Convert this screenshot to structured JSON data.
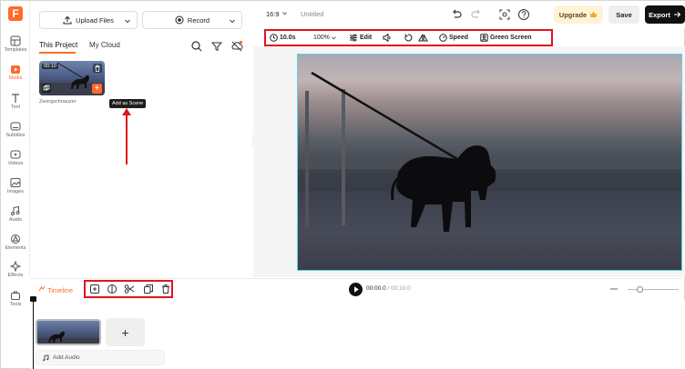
{
  "app": {
    "logo_letter": "F"
  },
  "rail": {
    "items": [
      {
        "label": "Templates",
        "icon": "templates-icon"
      },
      {
        "label": "Media",
        "icon": "media-icon",
        "active": true
      },
      {
        "label": "Text",
        "icon": "text-icon"
      },
      {
        "label": "Subtitles",
        "icon": "subtitles-icon"
      },
      {
        "label": "Videos",
        "icon": "videos-icon"
      },
      {
        "label": "Images",
        "icon": "images-icon"
      },
      {
        "label": "Audio",
        "icon": "audio-icon"
      },
      {
        "label": "Elements",
        "icon": "elements-icon"
      },
      {
        "label": "Effects",
        "icon": "effects-icon"
      },
      {
        "label": "Tools",
        "icon": "tools-icon"
      }
    ]
  },
  "media_panel": {
    "upload_label": "Upload Files",
    "record_label": "Record",
    "tabs": [
      "This Project",
      "My Cloud"
    ],
    "thumb_duration": "00:10",
    "thumb_name": "Zwergschnauzer",
    "tooltip": "Add as Scene",
    "add_symbol": "+"
  },
  "topbar": {
    "ratio": "16:9",
    "title": "Untitled",
    "upgrade_label": "Upgrade",
    "save_label": "Save",
    "export_label": "Export"
  },
  "toolbar": {
    "duration": "10.0s",
    "zoom": "100%",
    "edit": "Edit",
    "speed": "Speed",
    "green_screen": "Green Screen"
  },
  "timeline": {
    "label": "Timeline",
    "current_time": "00:00.0",
    "total_time": "/ 00:10.0",
    "add_scene_symbol": "+",
    "add_audio_label": "Add Audio"
  },
  "colors": {
    "accent": "#ff6a2a",
    "highlight_box": "#e1141c",
    "canvas_border": "#5cd4e8"
  }
}
